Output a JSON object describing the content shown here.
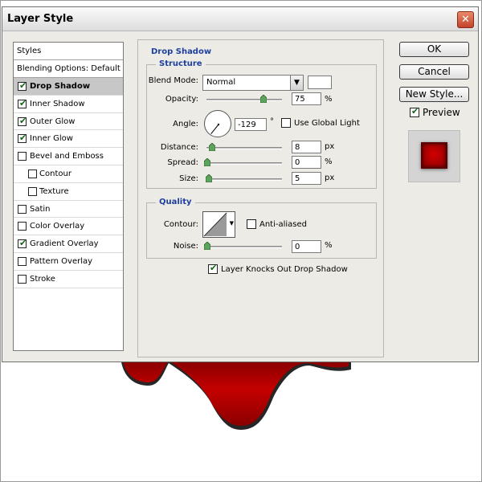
{
  "dialog": {
    "title": "Layer Style",
    "close_glyph": "✕"
  },
  "styles_panel": {
    "header": "Styles",
    "blending_options": "Blending Options: Default",
    "items": [
      {
        "label": "Drop Shadow",
        "checked": true,
        "selected": true,
        "sub": false
      },
      {
        "label": "Inner Shadow",
        "checked": true,
        "selected": false,
        "sub": false
      },
      {
        "label": "Outer Glow",
        "checked": true,
        "selected": false,
        "sub": false
      },
      {
        "label": "Inner Glow",
        "checked": true,
        "selected": false,
        "sub": false
      },
      {
        "label": "Bevel and Emboss",
        "checked": false,
        "selected": false,
        "sub": false
      },
      {
        "label": "Contour",
        "checked": false,
        "selected": false,
        "sub": true
      },
      {
        "label": "Texture",
        "checked": false,
        "selected": false,
        "sub": true
      },
      {
        "label": "Satin",
        "checked": false,
        "selected": false,
        "sub": false
      },
      {
        "label": "Color Overlay",
        "checked": false,
        "selected": false,
        "sub": false
      },
      {
        "label": "Gradient Overlay",
        "checked": true,
        "selected": false,
        "sub": false
      },
      {
        "label": "Pattern Overlay",
        "checked": false,
        "selected": false,
        "sub": false
      },
      {
        "label": "Stroke",
        "checked": false,
        "selected": false,
        "sub": false
      }
    ]
  },
  "drop_shadow": {
    "title": "Drop Shadow",
    "structure": {
      "title": "Structure",
      "blend_mode_label": "Blend Mode:",
      "blend_mode_value": "Normal",
      "opacity_label": "Opacity:",
      "opacity_value": "75",
      "opacity_unit": "%",
      "opacity_fraction": 0.75,
      "angle_label": "Angle:",
      "angle_value": "-129",
      "angle_unit": "°",
      "use_global_light_label": "Use Global Light",
      "use_global_light_checked": false,
      "distance_label": "Distance:",
      "distance_value": "8",
      "distance_unit": "px",
      "spread_label": "Spread:",
      "spread_value": "0",
      "spread_unit": "%",
      "size_label": "Size:",
      "size_value": "5",
      "size_unit": "px"
    },
    "quality": {
      "title": "Quality",
      "contour_label": "Contour:",
      "anti_aliased_label": "Anti-aliased",
      "anti_aliased_checked": false,
      "noise_label": "Noise:",
      "noise_value": "0",
      "noise_unit": "%"
    },
    "layer_knocks_out_label": "Layer Knocks Out Drop Shadow",
    "layer_knocks_out_checked": true
  },
  "buttons": {
    "ok": "OK",
    "cancel": "Cancel",
    "new_style": "New Style...",
    "preview_label": "Preview",
    "preview_checked": true
  },
  "colors": {
    "shape_red": "#b00000",
    "accent_blue": "#1e3fa0",
    "checkmark_green": "#116611"
  }
}
